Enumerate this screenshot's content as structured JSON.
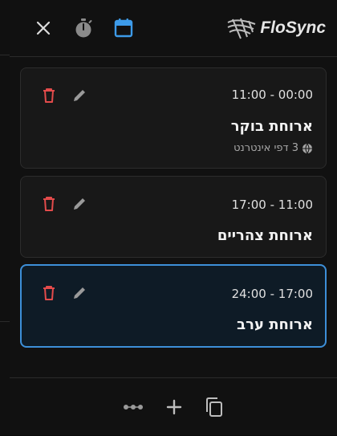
{
  "header": {
    "close_icon": "close-icon",
    "timer_icon": "timer-icon",
    "calendar_icon": "calendar-icon",
    "logo_text": "FloSync",
    "accent": "#3d9be9"
  },
  "cards": [
    {
      "time": "11:00 - 00:00",
      "title": "ארוחת בוקר",
      "meta": "3 דפי אינטרנט"
    },
    {
      "time": "17:00 - 11:00",
      "title": "ארוחת צהריים"
    },
    {
      "time": "24:00 - 17:00",
      "title": "ארוחת ערב",
      "selected": true
    }
  ],
  "colors": {
    "delete": "#e34b4b",
    "edit": "#9a9a9a",
    "selected_border": "#3d8fd8"
  },
  "footer": {
    "more_icon": "more-icon",
    "add_icon": "add-icon",
    "copy_icon": "copy-icon"
  }
}
